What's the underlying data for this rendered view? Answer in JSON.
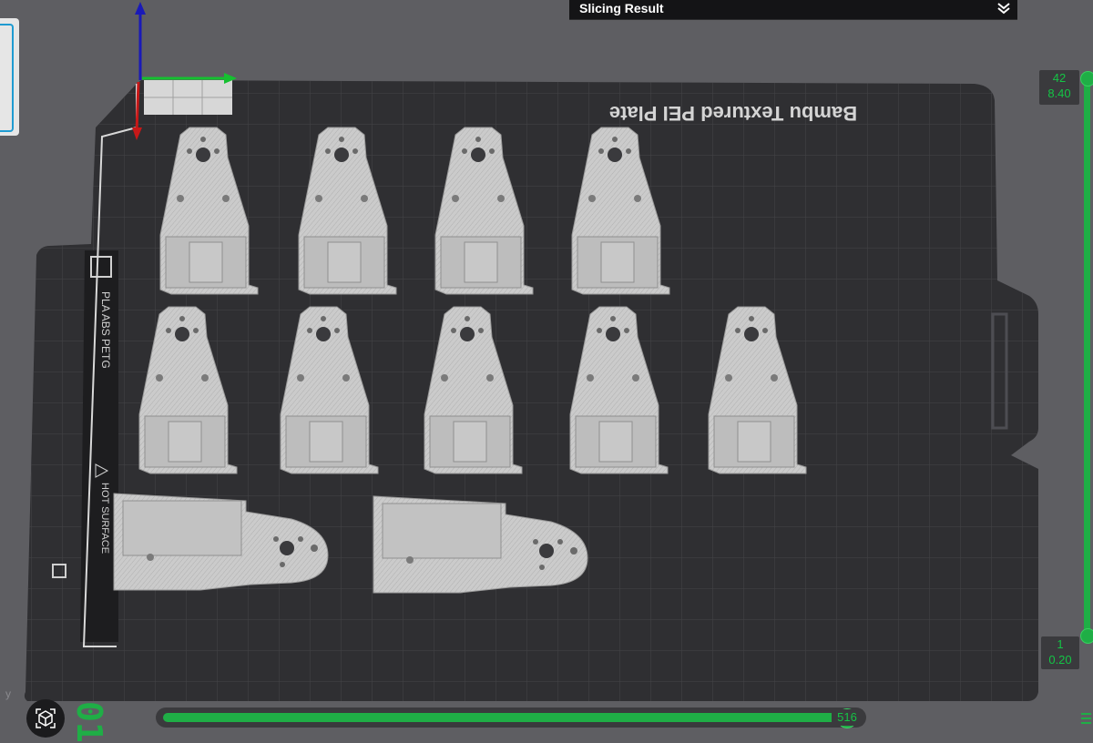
{
  "panel": {
    "title": "Slicing Result",
    "collapse_icon": "double-chevron-down-icon"
  },
  "plate": {
    "name": "Bambu Textured PEI Plate",
    "sticker_materials": "PLA ABS PETG",
    "sticker_warning": "HOT SURFACE",
    "sticker_warning_icon": "warning-triangle-icon"
  },
  "layer_slider": {
    "top_layer": "42",
    "top_height": "8.40",
    "bottom_layer": "1",
    "bottom_height": "0.20",
    "layers_icon": "layers-icon"
  },
  "move_slider": {
    "value": "516",
    "progress": 0.99
  },
  "view": {
    "icon": "view-cube-icon",
    "layer_digits": "01",
    "axis_label": "y"
  },
  "colors": {
    "accent_green": "#1fae46",
    "background": "#5e5e62",
    "plate": "#2f2f32",
    "part": "#cdcdcd"
  },
  "parts": {
    "upright_count": 9,
    "flat_count": 2
  }
}
